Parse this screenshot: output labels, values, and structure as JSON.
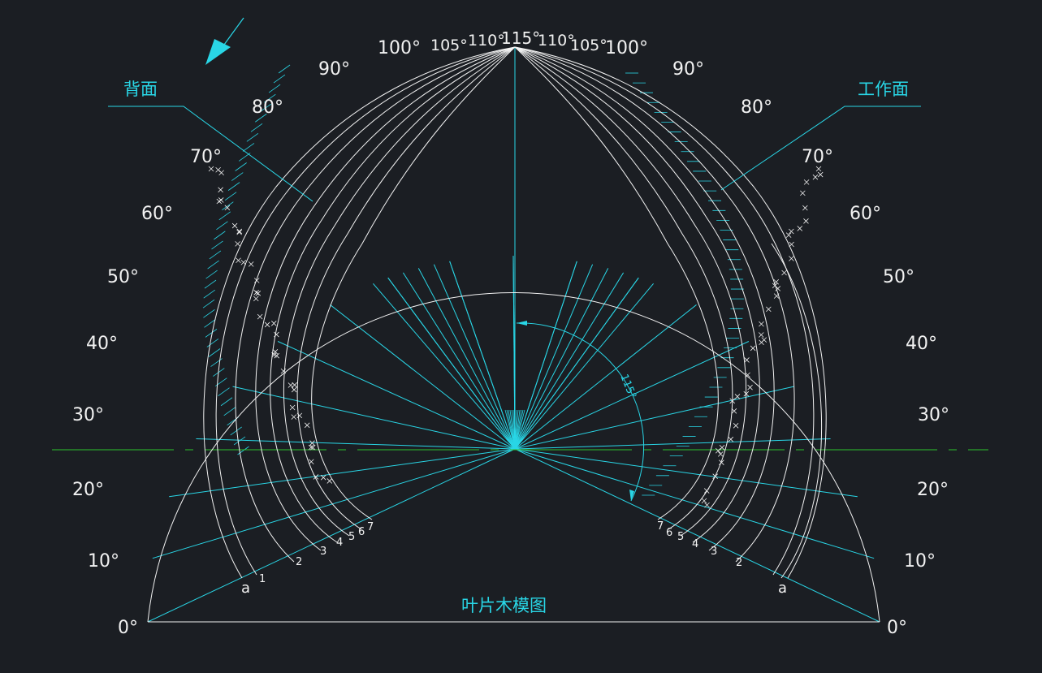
{
  "drawing": {
    "title": "叶片木模图",
    "back_face_label": "背面",
    "working_face_label": "工作面",
    "total_angle_label": "115°",
    "angle_labels_left": [
      "0°",
      "10°",
      "20°",
      "30°",
      "40°",
      "50°",
      "60°",
      "70°",
      "80°",
      "90°",
      "100°",
      "105°",
      "110°",
      "115°"
    ],
    "angle_labels_right": [
      "0°",
      "10°",
      "20°",
      "30°",
      "40°",
      "50°",
      "60°",
      "70°",
      "80°",
      "90°",
      "100°",
      "105°",
      "110°"
    ],
    "section_labels_left": [
      "a",
      "1",
      "2",
      "3",
      "4",
      "5",
      "6",
      "7"
    ],
    "section_labels_right": [
      "a",
      "2",
      "3",
      "4",
      "5",
      "6",
      "7"
    ]
  },
  "colors": {
    "background": "#1b1e23",
    "geometry": "#f2f2f2",
    "construction": "#29d6e6",
    "centerline": "#2ec42e"
  }
}
